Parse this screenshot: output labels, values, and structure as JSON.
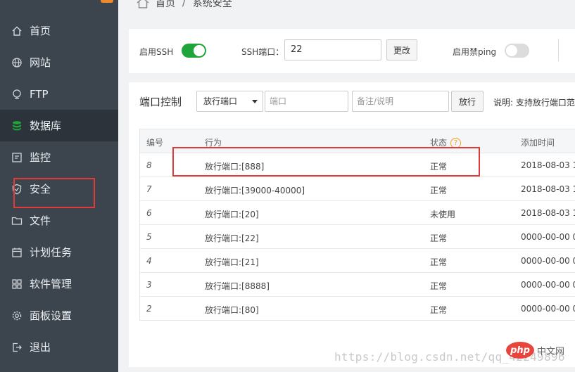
{
  "sidebar": {
    "items": [
      {
        "label": "首页",
        "icon": "home-icon"
      },
      {
        "label": "网站",
        "icon": "globe-icon"
      },
      {
        "label": "FTP",
        "icon": "ftp-icon"
      },
      {
        "label": "数据库",
        "icon": "database-icon"
      },
      {
        "label": "监控",
        "icon": "monitor-icon"
      },
      {
        "label": "安全",
        "icon": "shield-icon"
      },
      {
        "label": "文件",
        "icon": "folder-icon"
      },
      {
        "label": "计划任务",
        "icon": "calendar-icon"
      },
      {
        "label": "软件管理",
        "icon": "grid-icon"
      },
      {
        "label": "面板设置",
        "icon": "gear-icon"
      },
      {
        "label": "退出",
        "icon": "logout-icon"
      }
    ],
    "active_index": 3
  },
  "breadcrumb": {
    "home": "首页",
    "separator": "/",
    "current": "系统安全"
  },
  "ssh": {
    "enable_label": "启用SSH",
    "enable_state": "on",
    "port_label": "SSH端口：",
    "port_value": "22",
    "change_button": "更改",
    "ping_label": "启用禁ping",
    "ping_state": "off"
  },
  "port_control": {
    "title": "端口控制",
    "select_value": "放行端口",
    "port_placeholder": "端口",
    "remark_placeholder": "备注/说明",
    "add_button": "放行",
    "description": "说明: 支持放行端口范"
  },
  "table": {
    "headers": [
      "编号",
      "行为",
      "状态",
      "添加时间"
    ],
    "help_glyph": "?",
    "rows": [
      {
        "id": "8",
        "action": "放行端口:[888]",
        "status": "正常",
        "time": "2018-08-03 1"
      },
      {
        "id": "7",
        "action": "放行端口:[39000-40000]",
        "status": "正常",
        "time": "2018-08-03 1"
      },
      {
        "id": "6",
        "action": "放行端口:[20]",
        "status": "未使用",
        "time": "2018-08-03 1"
      },
      {
        "id": "5",
        "action": "放行端口:[22]",
        "status": "正常",
        "time": "0000-00-00 0"
      },
      {
        "id": "4",
        "action": "放行端口:[21]",
        "status": "正常",
        "time": "0000-00-00 0"
      },
      {
        "id": "3",
        "action": "放行端口:[8888]",
        "status": "正常",
        "time": "0000-00-00 0"
      },
      {
        "id": "2",
        "action": "放行端口:[80]",
        "status": "正常",
        "time": "0000-00-00 0"
      }
    ]
  },
  "watermark": {
    "url": "https://blog.csdn.net/qq_42249896",
    "logo": "php",
    "logo_text": "中文网"
  },
  "colors": {
    "sidebar_bg": "#3c444d",
    "active_bg": "#2c333a",
    "toggle_on": "#20a53a",
    "annotation_red": "#e13a3a"
  }
}
